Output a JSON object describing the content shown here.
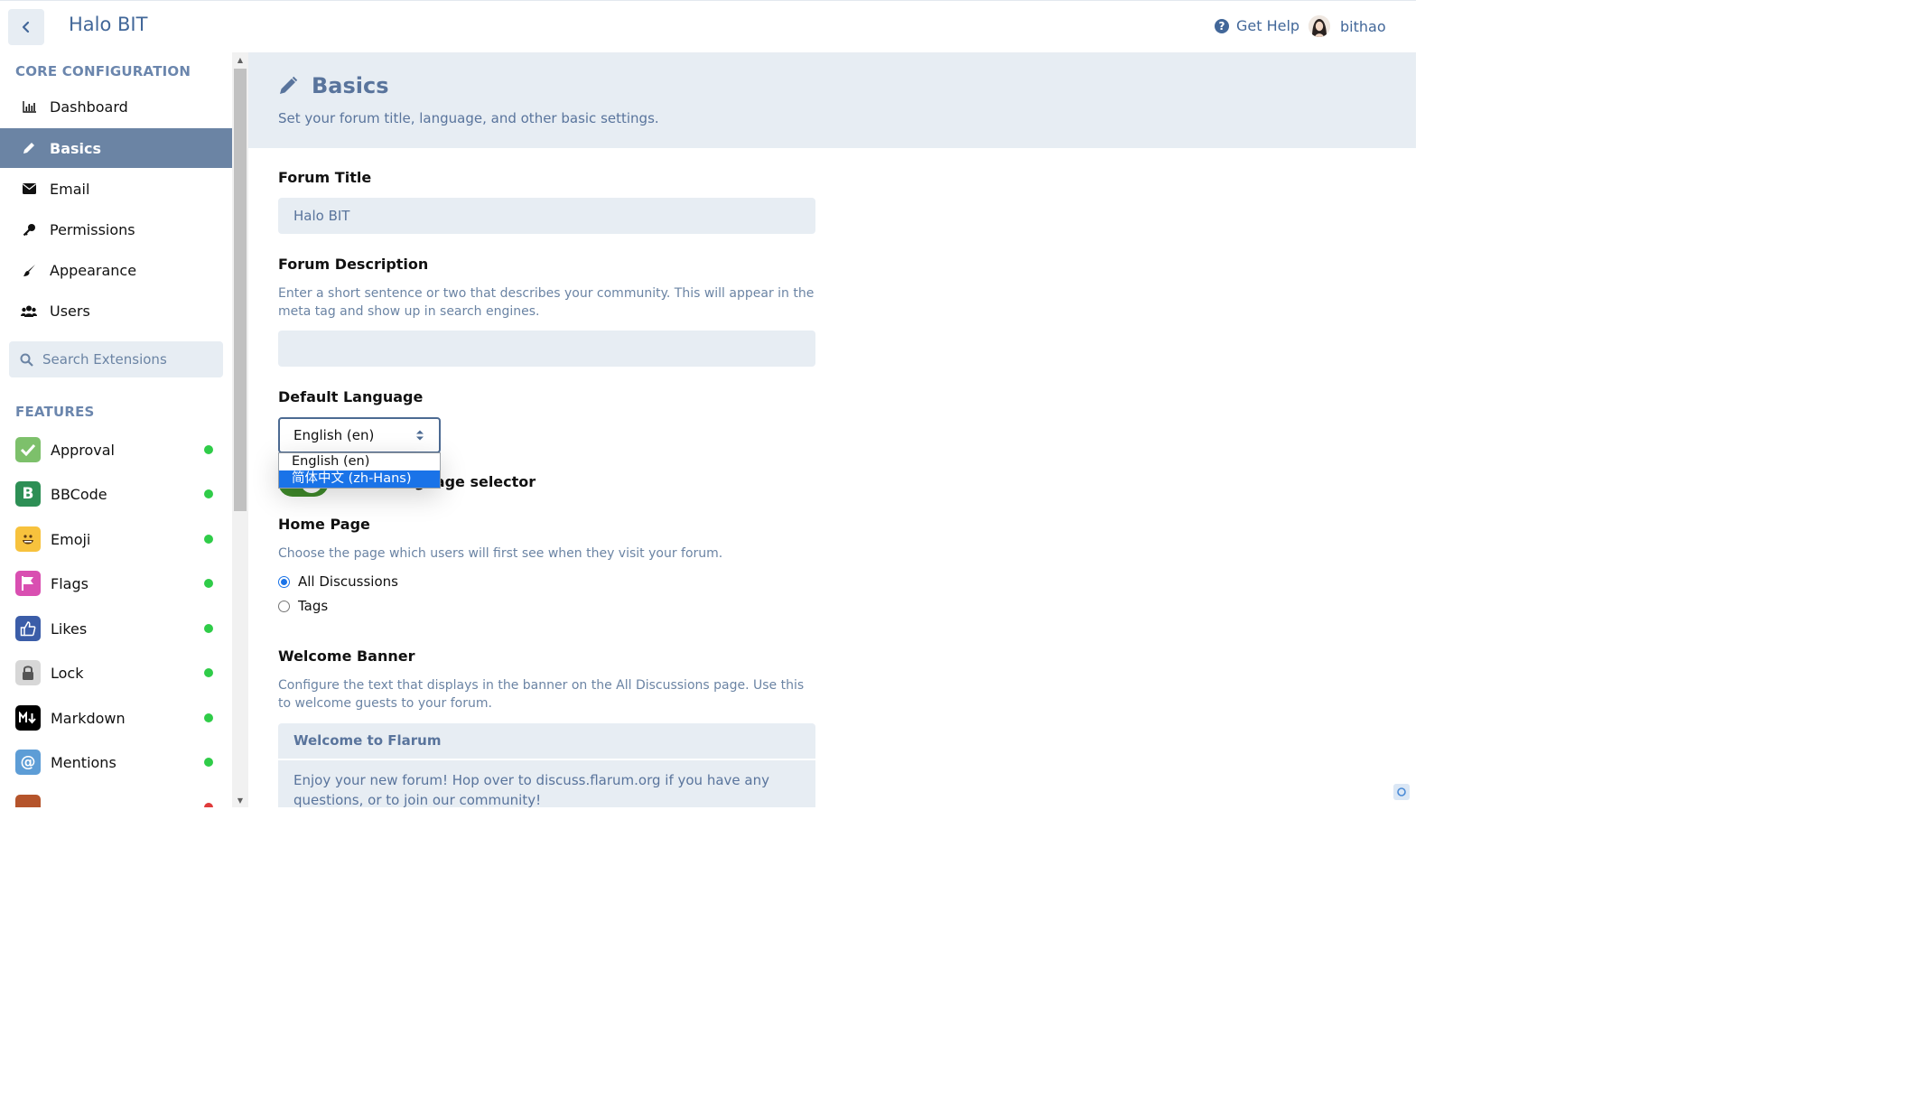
{
  "header": {
    "title": "Halo BIT",
    "get_help": "Get Help",
    "username": "bithao"
  },
  "sidebar": {
    "core_title": "CORE CONFIGURATION",
    "core_items": [
      {
        "label": "Dashboard",
        "icon": "chart-icon"
      },
      {
        "label": "Basics",
        "icon": "pencil-icon",
        "active": true
      },
      {
        "label": "Email",
        "icon": "envelope-icon"
      },
      {
        "label": "Permissions",
        "icon": "key-icon"
      },
      {
        "label": "Appearance",
        "icon": "paintbrush-icon"
      },
      {
        "label": "Users",
        "icon": "users-icon"
      }
    ],
    "search_placeholder": "Search Extensions",
    "features_title": "FEATURES",
    "extensions": [
      {
        "label": "Approval",
        "color": "#7dc06b",
        "status": "enabled"
      },
      {
        "label": "BBCode",
        "color": "#2d8f55",
        "status": "enabled"
      },
      {
        "label": "Emoji",
        "color": "#f7c23d",
        "status": "enabled"
      },
      {
        "label": "Flags",
        "color": "#d94fb1",
        "status": "enabled"
      },
      {
        "label": "Likes",
        "color": "#3b5da8",
        "status": "enabled"
      },
      {
        "label": "Lock",
        "color": "#d7d7d7",
        "status": "enabled"
      },
      {
        "label": "Markdown",
        "color": "#000000",
        "status": "enabled"
      },
      {
        "label": "Mentions",
        "color": "#5d9dd6",
        "status": "enabled"
      }
    ]
  },
  "page": {
    "title": "Basics",
    "description": "Set your forum title, language, and other basic settings.",
    "forum_title_label": "Forum Title",
    "forum_title_value": "Halo BIT",
    "forum_description_label": "Forum Description",
    "forum_description_help": "Enter a short sentence or two that describes your community. This will appear in the meta tag and show up in search engines.",
    "forum_description_value": "",
    "default_language_label": "Default Language",
    "language_selected": "English (en)",
    "language_options": [
      "English (en)",
      "简体中文 (zh-Hans)"
    ],
    "language_highlighted": "简体中文 (zh-Hans)",
    "show_language_selector_label": "Show language selector",
    "home_page_label": "Home Page",
    "home_page_help": "Choose the page which users will first see when they visit your forum.",
    "home_page_options": [
      {
        "label": "All Discussions",
        "checked": true
      },
      {
        "label": "Tags",
        "checked": false
      }
    ],
    "welcome_banner_label": "Welcome Banner",
    "welcome_banner_help": "Configure the text that displays in the banner on the All Discussions page. Use this to welcome guests to your forum.",
    "welcome_banner_title": "Welcome to Flarum",
    "welcome_banner_text": "Enjoy your new forum! Hop over to discuss.flarum.org if you have any questions, or to join our community!"
  },
  "colors": {
    "accent": "#426799",
    "active_nav": "#6b84a4",
    "panel": "#e7edf3",
    "status_enabled": "#2fcc48"
  }
}
